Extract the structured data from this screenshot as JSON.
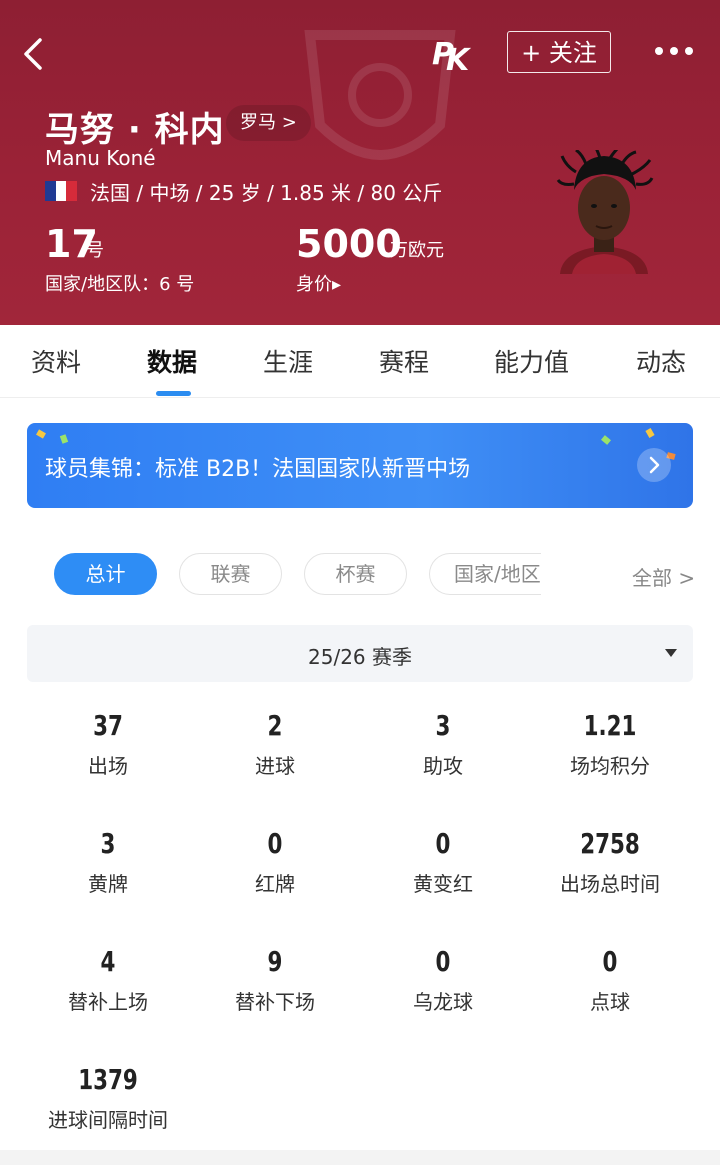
{
  "header": {
    "follow_label": "+ 关注",
    "player_name": "马努 · 科内",
    "club": "罗马 >",
    "english_name": "Manu Koné",
    "info": "法国 / 中场 / 25 岁 / 1.85 米 / 80 公斤",
    "shirt_number": "17",
    "shirt_unit": "号",
    "national_number": "国家/地区队：6 号",
    "market_value": "5000",
    "market_value_unit": "万欧元",
    "market_value_label": "身价▸",
    "accent_color": "#9b2237"
  },
  "tabs": [
    {
      "label": "资料"
    },
    {
      "label": "数据"
    },
    {
      "label": "生涯"
    },
    {
      "label": "赛程"
    },
    {
      "label": "能力值"
    },
    {
      "label": "动态"
    }
  ],
  "banner": {
    "text": "球员集锦：标准 B2B！法国国家队新晋中场"
  },
  "filters": {
    "chips": [
      {
        "label": "总计"
      },
      {
        "label": "联赛"
      },
      {
        "label": "杯赛"
      },
      {
        "label": "国家/地区"
      }
    ],
    "all_label": "全部 >"
  },
  "season": {
    "selected": "25/26 赛季"
  },
  "stats": [
    {
      "value": "37",
      "label": "出场"
    },
    {
      "value": "2",
      "label": "进球"
    },
    {
      "value": "3",
      "label": "助攻"
    },
    {
      "value": "1.21",
      "label": "场均积分"
    },
    {
      "value": "3",
      "label": "黄牌"
    },
    {
      "value": "0",
      "label": "红牌"
    },
    {
      "value": "0",
      "label": "黄变红"
    },
    {
      "value": "2758",
      "label": "出场总时间"
    },
    {
      "value": "4",
      "label": "替补上场"
    },
    {
      "value": "9",
      "label": "替补下场"
    },
    {
      "value": "0",
      "label": "乌龙球"
    },
    {
      "value": "0",
      "label": "点球"
    },
    {
      "value": "1379",
      "label": "进球间隔时间"
    }
  ]
}
